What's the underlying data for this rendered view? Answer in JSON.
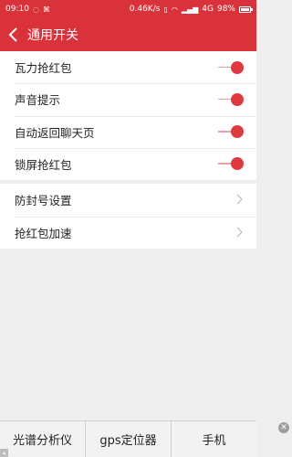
{
  "status_bar": {
    "time": "09:10",
    "net_speed": "0.46K/s",
    "network": "4G",
    "battery": "98%"
  },
  "header": {
    "title": "通用开关"
  },
  "toggles": [
    {
      "label": "瓦力抢红包",
      "on": true
    },
    {
      "label": "声音提示",
      "on": true
    },
    {
      "label": "自动返回聊天页",
      "on": true
    },
    {
      "label": "锁屏抢红包",
      "on": true
    }
  ],
  "links": [
    {
      "label": "防封号设置"
    },
    {
      "label": "抢红包加速"
    }
  ],
  "ad_bar": {
    "items": [
      "光谱分析仪",
      "gps定位器",
      "手机"
    ]
  },
  "colors": {
    "brand_red": "#d9323a",
    "toggle_on": "#e0393f"
  }
}
